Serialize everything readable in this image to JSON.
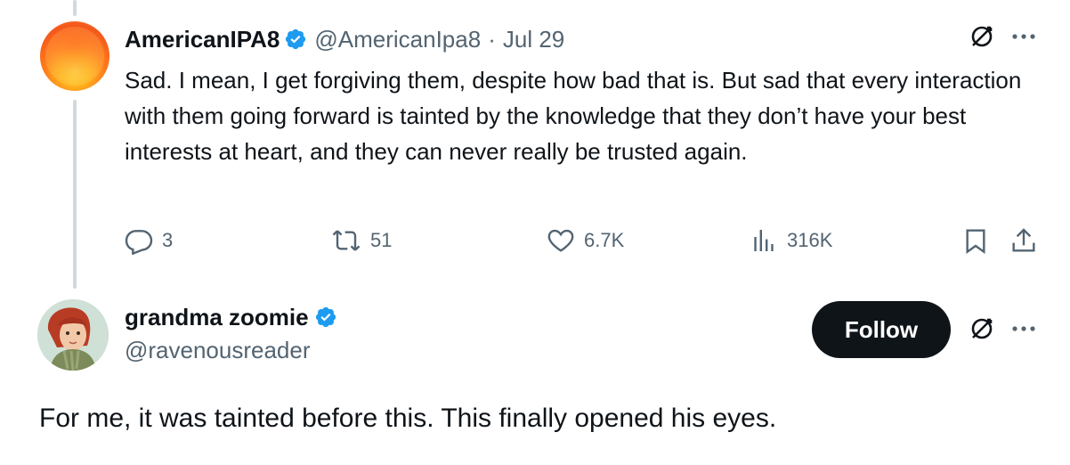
{
  "tweet": {
    "display_name": "AmericanIPA8",
    "handle": "@AmericanIpa8",
    "separator": "·",
    "date": "Jul 29",
    "text": "Sad. I mean, I get forgiving them, despite how bad that is. But sad that every interaction with them going forward is tainted by the knowledge that they don’t have your best interests at heart, and they can never really be trusted again.",
    "actions": {
      "reply_count": "3",
      "retweet_count": "51",
      "like_count": "6.7K",
      "view_count": "316K"
    }
  },
  "reply": {
    "display_name": "grandma zoomie",
    "handle": "@ravenousreader",
    "follow_label": "Follow",
    "text": "For me, it was tainted before this. This finally opened his eyes."
  },
  "colors": {
    "verified_blue": "#1d9bf0",
    "muted_gray": "#536471",
    "text_primary": "#0f1419",
    "thread_line": "#cfd9de"
  },
  "icons": [
    "verified-badge-icon",
    "grok-icon",
    "more-icon",
    "reply-icon",
    "retweet-icon",
    "like-icon",
    "views-icon",
    "bookmark-icon",
    "share-icon"
  ]
}
